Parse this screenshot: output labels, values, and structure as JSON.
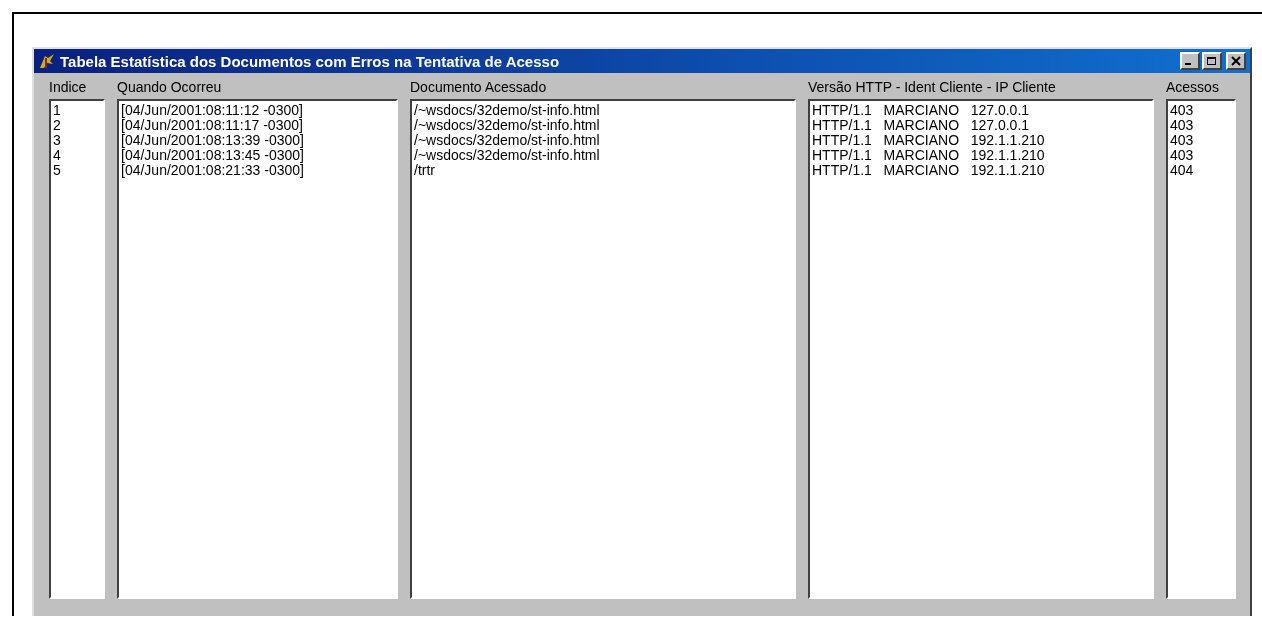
{
  "window": {
    "title": "Tabela Estatística dos Documentos com Erros na Tentativa de Acesso"
  },
  "columns": [
    {
      "header": "Indice",
      "items": [
        "1",
        "2",
        "3",
        "4",
        "5"
      ]
    },
    {
      "header": "Quando Ocorreu",
      "items": [
        "[04/Jun/2001:08:11:12 -0300]",
        "[04/Jun/2001:08:11:17 -0300]",
        "[04/Jun/2001:08:13:39 -0300]",
        "[04/Jun/2001:08:13:45 -0300]",
        "[04/Jun/2001:08:21:33 -0300]"
      ]
    },
    {
      "header": "Documento Acessado",
      "items": [
        "/~wsdocs/32demo/st-info.html",
        "/~wsdocs/32demo/st-info.html",
        "/~wsdocs/32demo/st-info.html",
        "/~wsdocs/32demo/st-info.html",
        "/trtr"
      ]
    },
    {
      "header": "Versão HTTP - Ident Cliente - IP Cliente",
      "items": [
        "HTTP/1.1   MARCIANO   127.0.0.1",
        "HTTP/1.1   MARCIANO   127.0.0.1",
        "HTTP/1.1   MARCIANO   192.1.1.210",
        "HTTP/1.1   MARCIANO   192.1.1.210",
        "HTTP/1.1   MARCIANO   192.1.1.210"
      ]
    },
    {
      "header": "Acessos",
      "items": [
        "403",
        "403",
        "403",
        "403",
        "404"
      ]
    }
  ]
}
